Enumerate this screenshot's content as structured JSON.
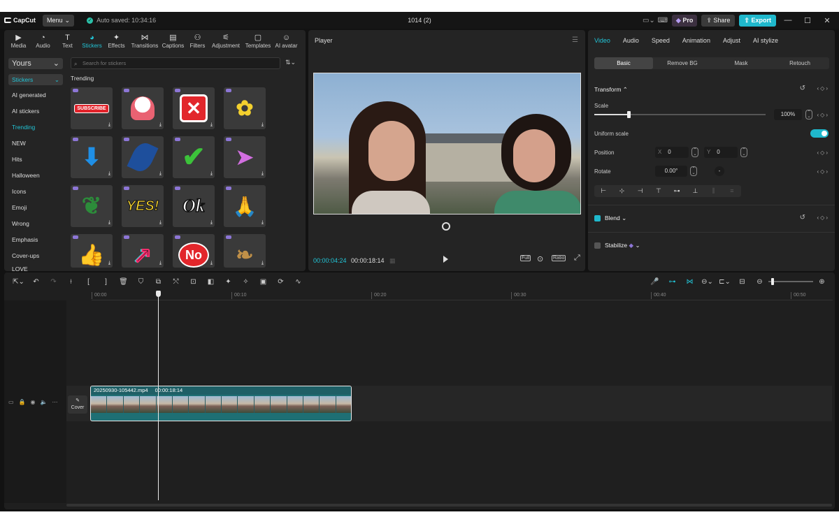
{
  "titlebar": {
    "app_name": "CapCut",
    "menu_label": "Menu",
    "autosave": "Auto saved: 10:34:16",
    "project_name": "1014 (2)",
    "pro_label": "Pro",
    "share_label": "Share",
    "export_label": "Export"
  },
  "media_tabs": [
    {
      "label": "Media",
      "icon": "media-icon"
    },
    {
      "label": "Audio",
      "icon": "audio-icon"
    },
    {
      "label": "Text",
      "icon": "text-icon"
    },
    {
      "label": "Stickers",
      "icon": "stickers-icon",
      "active": true
    },
    {
      "label": "Effects",
      "icon": "effects-icon"
    },
    {
      "label": "Transitions",
      "icon": "transitions-icon"
    },
    {
      "label": "Captions",
      "icon": "captions-icon"
    },
    {
      "label": "Filters",
      "icon": "filters-icon"
    },
    {
      "label": "Adjustment",
      "icon": "adjustment-icon"
    },
    {
      "label": "Templates",
      "icon": "templates-icon"
    },
    {
      "label": "AI avatar",
      "icon": "ai-avatar-icon"
    }
  ],
  "sticker_sidebar": {
    "dropdown": "Yours",
    "selected": "Stickers",
    "items": [
      "AI generated",
      "AI stickers",
      "Trending",
      "NEW",
      "Hits",
      "Halloween",
      "Icons",
      "Emoji",
      "Wrong",
      "Emphasis",
      "Cover-ups",
      "LOVE"
    ],
    "highlighted": "Trending"
  },
  "search": {
    "placeholder": "Search for stickers"
  },
  "section_title": "Trending",
  "stickers": [
    {
      "name": "subscribe-sticker",
      "text": "SUBSCRIBE"
    },
    {
      "name": "cupcake-sticker",
      "text": ""
    },
    {
      "name": "red-x-sticker",
      "text": ""
    },
    {
      "name": "yellow-rose-sticker",
      "text": ""
    },
    {
      "name": "blue-arrow-down-sticker",
      "text": ""
    },
    {
      "name": "blue-leaf-sticker",
      "text": ""
    },
    {
      "name": "green-check-sticker",
      "text": ""
    },
    {
      "name": "paper-plane-sticker",
      "text": ""
    },
    {
      "name": "monstera-plant-sticker",
      "text": ""
    },
    {
      "name": "yes-burst-sticker",
      "text": "YES!"
    },
    {
      "name": "ok-text-sticker",
      "text": "Ok"
    },
    {
      "name": "praying-hands-sticker",
      "text": ""
    },
    {
      "name": "thumbs-up-sticker",
      "text": ""
    },
    {
      "name": "tiktok-arrow-sticker",
      "text": ""
    },
    {
      "name": "no-bubble-sticker",
      "text": "No"
    },
    {
      "name": "dried-flowers-sticker",
      "text": ""
    }
  ],
  "player": {
    "title": "Player",
    "current_time": "00:00:04:24",
    "total_time": "00:00:18:14",
    "full_label": "Full",
    "ratio_label": "Ratio"
  },
  "properties": {
    "tabs": [
      "Video",
      "Audio",
      "Speed",
      "Animation",
      "Adjust",
      "AI stylize"
    ],
    "active_tab": "Video",
    "subtabs": [
      "Basic",
      "Remove BG",
      "Mask",
      "Retouch"
    ],
    "active_subtab": "Basic",
    "transform_title": "Transform",
    "scale_label": "Scale",
    "scale_value": "100%",
    "scale_fraction": 0.2,
    "uniform_scale_label": "Uniform scale",
    "position_label": "Position",
    "pos_x_label": "X",
    "pos_x": "0",
    "pos_y_label": "Y",
    "pos_y": "0",
    "rotate_label": "Rotate",
    "rotate_value": "0.00°",
    "blend_label": "Blend",
    "stabilize_label": "Stabilize"
  },
  "timeline": {
    "ticks": [
      "00:00",
      "00:10",
      "00:20",
      "00:30",
      "00:40",
      "00:50"
    ],
    "clip_name": "20250930-105442.mp4",
    "clip_duration": "00:00:18:14",
    "cover_label": "Cover"
  },
  "colors": {
    "accent": "#22c4d6",
    "export": "#1fb8cc",
    "clip": "#1e6f74",
    "panel": "#242424"
  }
}
